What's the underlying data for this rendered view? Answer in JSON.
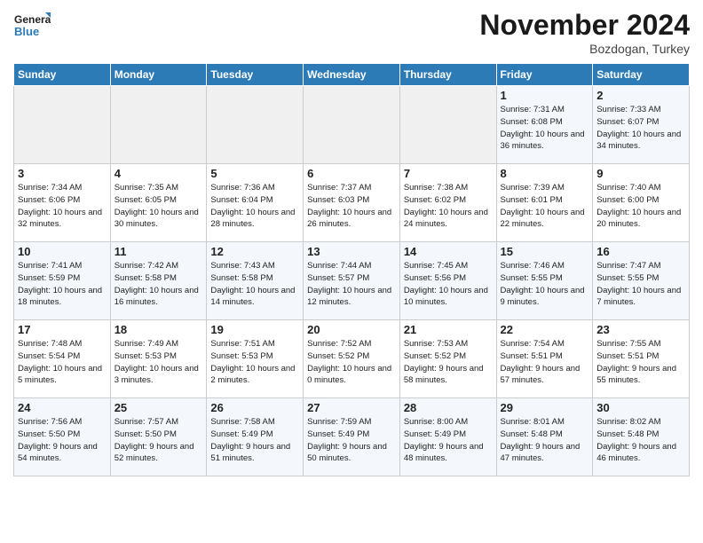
{
  "header": {
    "logo_line1": "General",
    "logo_line2": "Blue",
    "month": "November 2024",
    "location": "Bozdogan, Turkey"
  },
  "weekdays": [
    "Sunday",
    "Monday",
    "Tuesday",
    "Wednesday",
    "Thursday",
    "Friday",
    "Saturday"
  ],
  "weeks": [
    [
      {
        "day": "",
        "empty": true
      },
      {
        "day": "",
        "empty": true
      },
      {
        "day": "",
        "empty": true
      },
      {
        "day": "",
        "empty": true
      },
      {
        "day": "",
        "empty": true
      },
      {
        "day": "1",
        "sunrise": "Sunrise: 7:31 AM",
        "sunset": "Sunset: 6:08 PM",
        "daylight": "Daylight: 10 hours and 36 minutes."
      },
      {
        "day": "2",
        "sunrise": "Sunrise: 7:33 AM",
        "sunset": "Sunset: 6:07 PM",
        "daylight": "Daylight: 10 hours and 34 minutes."
      }
    ],
    [
      {
        "day": "3",
        "sunrise": "Sunrise: 7:34 AM",
        "sunset": "Sunset: 6:06 PM",
        "daylight": "Daylight: 10 hours and 32 minutes."
      },
      {
        "day": "4",
        "sunrise": "Sunrise: 7:35 AM",
        "sunset": "Sunset: 6:05 PM",
        "daylight": "Daylight: 10 hours and 30 minutes."
      },
      {
        "day": "5",
        "sunrise": "Sunrise: 7:36 AM",
        "sunset": "Sunset: 6:04 PM",
        "daylight": "Daylight: 10 hours and 28 minutes."
      },
      {
        "day": "6",
        "sunrise": "Sunrise: 7:37 AM",
        "sunset": "Sunset: 6:03 PM",
        "daylight": "Daylight: 10 hours and 26 minutes."
      },
      {
        "day": "7",
        "sunrise": "Sunrise: 7:38 AM",
        "sunset": "Sunset: 6:02 PM",
        "daylight": "Daylight: 10 hours and 24 minutes."
      },
      {
        "day": "8",
        "sunrise": "Sunrise: 7:39 AM",
        "sunset": "Sunset: 6:01 PM",
        "daylight": "Daylight: 10 hours and 22 minutes."
      },
      {
        "day": "9",
        "sunrise": "Sunrise: 7:40 AM",
        "sunset": "Sunset: 6:00 PM",
        "daylight": "Daylight: 10 hours and 20 minutes."
      }
    ],
    [
      {
        "day": "10",
        "sunrise": "Sunrise: 7:41 AM",
        "sunset": "Sunset: 5:59 PM",
        "daylight": "Daylight: 10 hours and 18 minutes."
      },
      {
        "day": "11",
        "sunrise": "Sunrise: 7:42 AM",
        "sunset": "Sunset: 5:58 PM",
        "daylight": "Daylight: 10 hours and 16 minutes."
      },
      {
        "day": "12",
        "sunrise": "Sunrise: 7:43 AM",
        "sunset": "Sunset: 5:58 PM",
        "daylight": "Daylight: 10 hours and 14 minutes."
      },
      {
        "day": "13",
        "sunrise": "Sunrise: 7:44 AM",
        "sunset": "Sunset: 5:57 PM",
        "daylight": "Daylight: 10 hours and 12 minutes."
      },
      {
        "day": "14",
        "sunrise": "Sunrise: 7:45 AM",
        "sunset": "Sunset: 5:56 PM",
        "daylight": "Daylight: 10 hours and 10 minutes."
      },
      {
        "day": "15",
        "sunrise": "Sunrise: 7:46 AM",
        "sunset": "Sunset: 5:55 PM",
        "daylight": "Daylight: 10 hours and 9 minutes."
      },
      {
        "day": "16",
        "sunrise": "Sunrise: 7:47 AM",
        "sunset": "Sunset: 5:55 PM",
        "daylight": "Daylight: 10 hours and 7 minutes."
      }
    ],
    [
      {
        "day": "17",
        "sunrise": "Sunrise: 7:48 AM",
        "sunset": "Sunset: 5:54 PM",
        "daylight": "Daylight: 10 hours and 5 minutes."
      },
      {
        "day": "18",
        "sunrise": "Sunrise: 7:49 AM",
        "sunset": "Sunset: 5:53 PM",
        "daylight": "Daylight: 10 hours and 3 minutes."
      },
      {
        "day": "19",
        "sunrise": "Sunrise: 7:51 AM",
        "sunset": "Sunset: 5:53 PM",
        "daylight": "Daylight: 10 hours and 2 minutes."
      },
      {
        "day": "20",
        "sunrise": "Sunrise: 7:52 AM",
        "sunset": "Sunset: 5:52 PM",
        "daylight": "Daylight: 10 hours and 0 minutes."
      },
      {
        "day": "21",
        "sunrise": "Sunrise: 7:53 AM",
        "sunset": "Sunset: 5:52 PM",
        "daylight": "Daylight: 9 hours and 58 minutes."
      },
      {
        "day": "22",
        "sunrise": "Sunrise: 7:54 AM",
        "sunset": "Sunset: 5:51 PM",
        "daylight": "Daylight: 9 hours and 57 minutes."
      },
      {
        "day": "23",
        "sunrise": "Sunrise: 7:55 AM",
        "sunset": "Sunset: 5:51 PM",
        "daylight": "Daylight: 9 hours and 55 minutes."
      }
    ],
    [
      {
        "day": "24",
        "sunrise": "Sunrise: 7:56 AM",
        "sunset": "Sunset: 5:50 PM",
        "daylight": "Daylight: 9 hours and 54 minutes."
      },
      {
        "day": "25",
        "sunrise": "Sunrise: 7:57 AM",
        "sunset": "Sunset: 5:50 PM",
        "daylight": "Daylight: 9 hours and 52 minutes."
      },
      {
        "day": "26",
        "sunrise": "Sunrise: 7:58 AM",
        "sunset": "Sunset: 5:49 PM",
        "daylight": "Daylight: 9 hours and 51 minutes."
      },
      {
        "day": "27",
        "sunrise": "Sunrise: 7:59 AM",
        "sunset": "Sunset: 5:49 PM",
        "daylight": "Daylight: 9 hours and 50 minutes."
      },
      {
        "day": "28",
        "sunrise": "Sunrise: 8:00 AM",
        "sunset": "Sunset: 5:49 PM",
        "daylight": "Daylight: 9 hours and 48 minutes."
      },
      {
        "day": "29",
        "sunrise": "Sunrise: 8:01 AM",
        "sunset": "Sunset: 5:48 PM",
        "daylight": "Daylight: 9 hours and 47 minutes."
      },
      {
        "day": "30",
        "sunrise": "Sunrise: 8:02 AM",
        "sunset": "Sunset: 5:48 PM",
        "daylight": "Daylight: 9 hours and 46 minutes."
      }
    ]
  ]
}
